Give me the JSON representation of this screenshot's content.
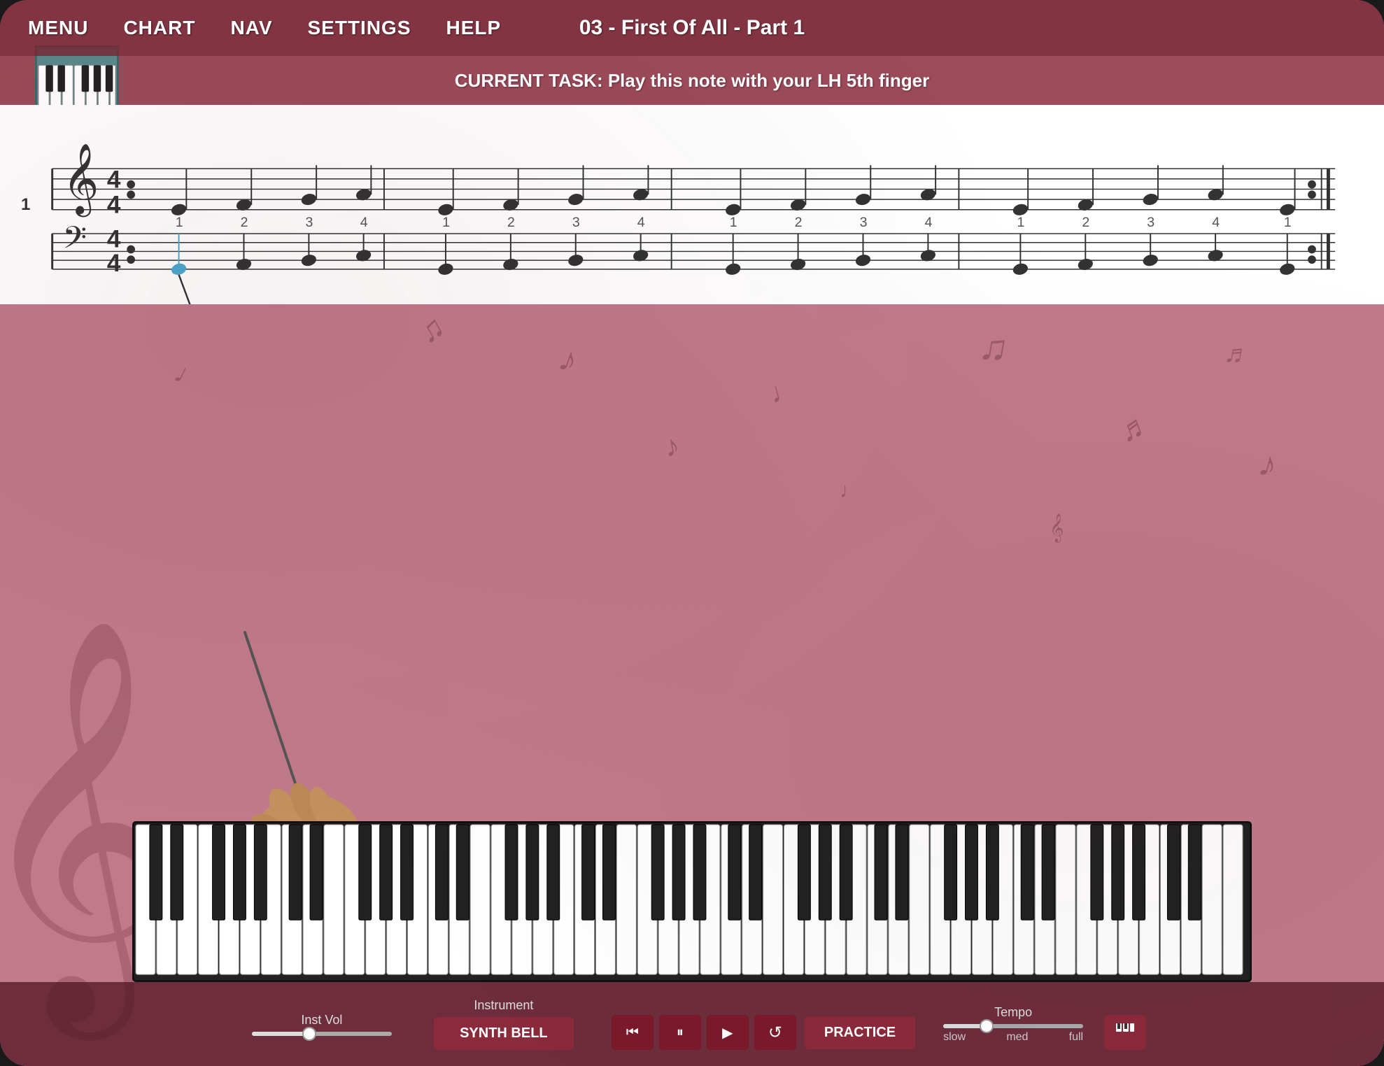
{
  "app": {
    "title": "03 - First Of All - Part 1",
    "bg_color": "#c17a8a",
    "nav_bg": "rgba(120,40,55,0.85)"
  },
  "nav": {
    "items": [
      "MENU",
      "CHART",
      "NAV",
      "SETTINGS",
      "HELP"
    ]
  },
  "task": {
    "text": "CURRENT TASK: Play this note with your LH 5th finger"
  },
  "sheet": {
    "measure_number": "1",
    "time_signature": "4/4",
    "beat_labels": [
      "1",
      "2",
      "3",
      "4",
      "1",
      "2",
      "3",
      "4",
      "1",
      "2",
      "3",
      "4",
      "1",
      "2",
      "3",
      "4",
      "1"
    ]
  },
  "controls": {
    "inst_vol_label": "Inst Vol",
    "instrument_label": "Instrument",
    "instrument_name": "SYNTH BELL",
    "tempo_label": "Tempo",
    "tempo_slow": "slow",
    "tempo_med": "med",
    "tempo_full": "full",
    "practice_label": "PRACTICE",
    "rewind_icon": "⏮",
    "pause_icon": "⏸",
    "play_icon": "▶",
    "loop_icon": "↺",
    "grid_icon": "⊞"
  }
}
